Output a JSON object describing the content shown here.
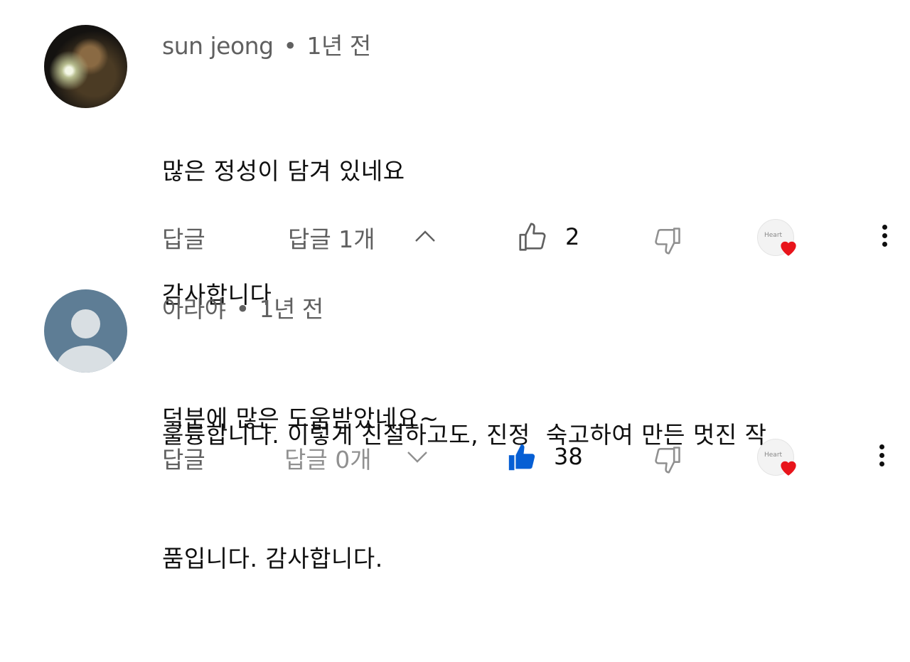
{
  "comments": [
    {
      "author": "sun jeong",
      "separator": "•",
      "time": "1년 전",
      "lines": [
        "많은 정성이 담겨 있네요",
        "감사합니다",
        "덕분에 많은 도움받았네요~"
      ],
      "reply_label": "답글",
      "replies_label": "답글 1개",
      "replies_expanded": true,
      "likes": "2",
      "liked": false,
      "badge_text": "Heart"
    },
    {
      "author": "아라야",
      "separator": "•",
      "time": "1년 전",
      "lines": [
        "훌륭합니다. 이렇게 친절하고도, 진정  숙고하여 만든 멋진 작",
        "품입니다. 감사합니다."
      ],
      "reply_label": "답글",
      "replies_label": "답글 0개",
      "replies_expanded": false,
      "likes": "38",
      "liked": true,
      "badge_text": "Heart"
    }
  ],
  "colors": {
    "like_active": "#065fd4",
    "icon_muted": "#909090",
    "heart": "#e8141b"
  },
  "icons": [
    "thumb-up-icon",
    "thumb-down-icon",
    "chevron-up-icon",
    "chevron-down-icon",
    "heart-icon",
    "more-vert-icon"
  ]
}
